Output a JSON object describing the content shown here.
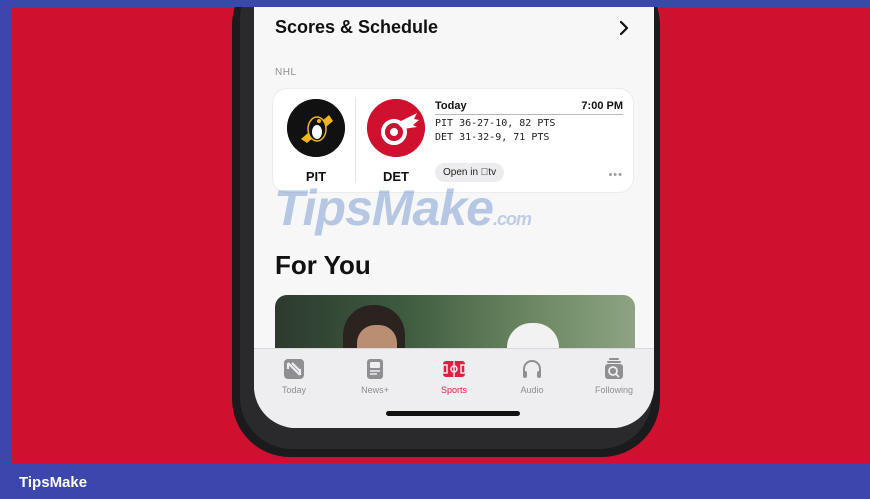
{
  "scores_section": {
    "title": "Scores & Schedule",
    "league": "NHL"
  },
  "game": {
    "home": {
      "abbr": "PIT"
    },
    "away": {
      "abbr": "DET"
    },
    "day": "Today",
    "time": "7:00 PM",
    "pit_line": "PIT 36-27-10, 82 PTS",
    "det_line": "DET 31-32-9, 71 PTS",
    "open_label": "Open in tv",
    "more": "•••"
  },
  "watermark": {
    "main": "TipsMake",
    "suffix": ".com"
  },
  "for_you": {
    "title": "For You"
  },
  "tabs": [
    {
      "label": "Today",
      "icon": "news-icon"
    },
    {
      "label": "News+",
      "icon": "news-plus-icon"
    },
    {
      "label": "Sports",
      "icon": "sports-icon",
      "active": true
    },
    {
      "label": "Audio",
      "icon": "headphones-icon"
    },
    {
      "label": "Following",
      "icon": "following-icon"
    }
  ],
  "footer": {
    "brand": "TipsMake"
  },
  "colors": {
    "background": "#d0102f",
    "frame": "#3b47ad",
    "accent": "#e11d42"
  }
}
